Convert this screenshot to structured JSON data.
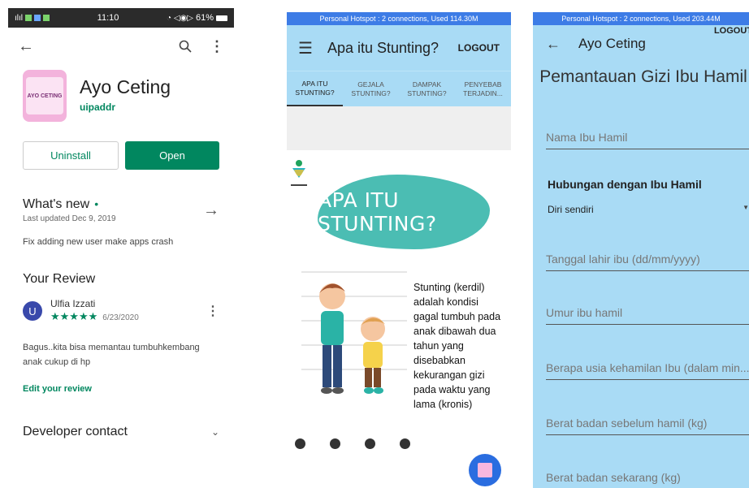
{
  "screen1": {
    "status": {
      "time": "11:10",
      "battery": "61%"
    },
    "app": {
      "name": "Ayo Ceting",
      "developer": "uipaddr",
      "icon_text": "AYO CETING"
    },
    "buttons": {
      "uninstall": "Uninstall",
      "open": "Open"
    },
    "whats_new": {
      "title": "What's new",
      "updated": "Last updated Dec 9, 2019",
      "text": "Fix adding new user make apps crash"
    },
    "review": {
      "title": "Your Review",
      "user": "Ulfia Izzati",
      "avatar_letter": "U",
      "stars": "★★★★★",
      "date": "6/23/2020",
      "text": "Bagus..kita bisa memantau tumbuhkembang anak cukup di hp",
      "edit": "Edit your review"
    },
    "developer_contact": "Developer contact",
    "icons": [
      "back-arrow-icon",
      "search-icon",
      "more-vert-icon",
      "arrow-right-icon",
      "chevron-down-icon"
    ]
  },
  "screen2": {
    "hotspot": "Personal Hotspot : 2 connections, Used 114.30M",
    "title": "Apa itu Stunting?",
    "logout": "LOGOUT",
    "tabs": [
      {
        "line1": "APA ITU",
        "line2": "STUNTING?"
      },
      {
        "line1": "GEJALA",
        "line2": "STUNTING?"
      },
      {
        "line1": "DAMPAK",
        "line2": "STUNTING?"
      },
      {
        "line1": "PENYEBAB",
        "line2": "TERJADIN..."
      }
    ],
    "banner": "APA ITU STUNTING?",
    "description": "Stunting (kerdil) adalah kondisi gagal tumbuh pada anak dibawah dua tahun yang disebabkan kekurangan gizi pada waktu yang lama (kronis)"
  },
  "screen3": {
    "hotspot": "Personal Hotspot : 2 connections, Used 203.44M",
    "title": "Ayo Ceting",
    "logout": "LOGOUT",
    "form_title": "Pemantauan Gizi Ibu Hamil",
    "fields": {
      "nama": "Nama Ibu Hamil",
      "relation_label": "Hubungan dengan Ibu Hamil",
      "relation_value": "Diri sendiri",
      "tanggal": "Tanggal lahir ibu (dd/mm/yyyy)",
      "umur": "Umur ibu hamil",
      "usia_kehamilan": "Berapa usia kehamilan Ibu (dalam min...",
      "berat_sebelum": "Berat badan sebelum hamil (kg)",
      "berat_sekarang": "Berat badan sekarang (kg)"
    }
  },
  "colors": {
    "play_green": "#01875f",
    "app_blue": "#a9dbf5",
    "hotspot_blue": "#3d7ce6",
    "teal": "#4bbdb3"
  }
}
